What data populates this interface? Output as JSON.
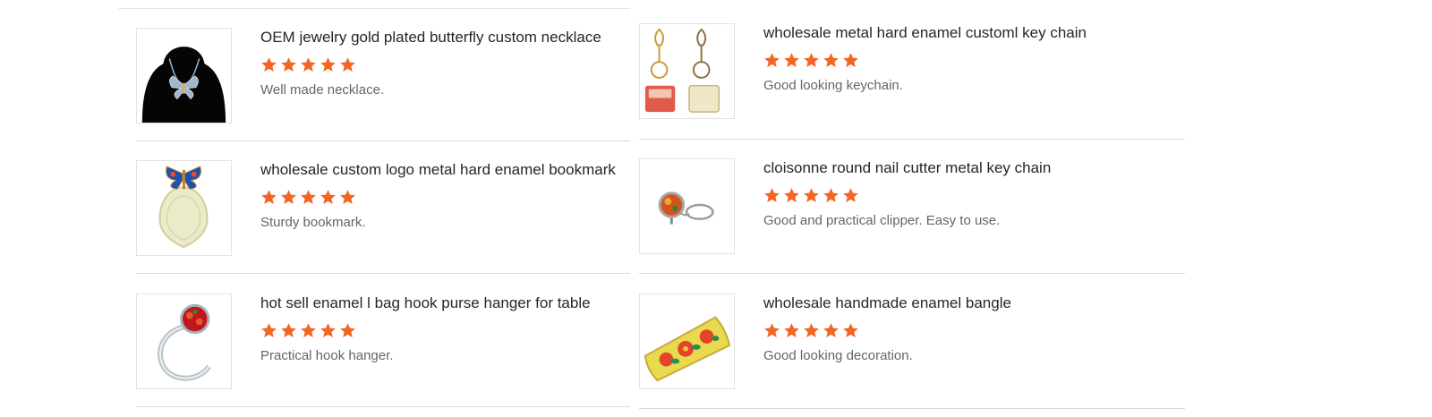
{
  "reviews": {
    "left": [
      {
        "title": "OEM jewelry gold plated butterfly custom necklace",
        "rating": 5,
        "comment": "Well made necklace.",
        "image": "butterfly-necklace-image"
      },
      {
        "title": "wholesale custom logo metal hard enamel bookmark",
        "rating": 5,
        "comment": "Sturdy bookmark.",
        "image": "butterfly-bookmark-image"
      },
      {
        "title": "hot sell enamel l bag hook purse hanger for table",
        "rating": 5,
        "comment": "Practical hook hanger.",
        "image": "purse-hook-image"
      }
    ],
    "right": [
      {
        "title": "wholesale metal hard enamel customl key chain",
        "rating": 5,
        "comment": "Good looking keychain.",
        "image": "key-chain-image"
      },
      {
        "title": "cloisonne round nail cutter metal key chain",
        "rating": 5,
        "comment": "Good and practical clipper. Easy to use.",
        "image": "nail-cutter-image"
      },
      {
        "title": "wholesale handmade enamel bangle",
        "rating": 5,
        "comment": "Good looking decoration.",
        "image": "enamel-bangle-image"
      }
    ]
  },
  "colors": {
    "star": "#f26522"
  }
}
